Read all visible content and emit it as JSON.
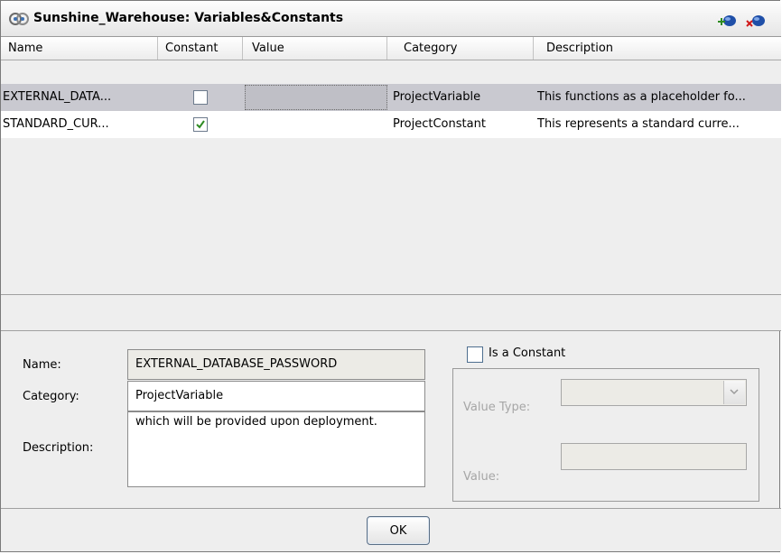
{
  "window": {
    "title": "Sunshine_Warehouse: Variables&Constants",
    "title_icon": "variables-icon",
    "toolbar": [
      {
        "name": "add-variable-button",
        "icon": "add-icon"
      },
      {
        "name": "remove-variable-button",
        "icon": "remove-icon"
      }
    ]
  },
  "table": {
    "columns": [
      "Name",
      "Constant",
      "Value",
      "Category",
      "Description"
    ],
    "rows": [
      {
        "name": "EXTERNAL_DATA...",
        "constant": false,
        "value": "",
        "category": "ProjectVariable",
        "description": "This functions as a placeholder fo...",
        "selected": true
      },
      {
        "name": "STANDARD_CUR...",
        "constant": true,
        "value": "",
        "category": "ProjectConstant",
        "description": "This represents a standard curre...",
        "selected": false
      }
    ]
  },
  "form": {
    "name_label": "Name:",
    "name_value": "EXTERNAL_DATABASE_PASSWORD",
    "category_label": "Category:",
    "category_value": "ProjectVariable",
    "description_label": "Description:",
    "description_value": "which will be provided upon deployment.",
    "is_constant_label": "Is a Constant",
    "is_constant_checked": false,
    "value_type_label": "Value Type:",
    "value_type_selected": "",
    "value_label": "Value:",
    "value_value": ""
  },
  "footer": {
    "ok_label": "OK"
  },
  "colors": {
    "selected_row": "#c9c9d0",
    "checkmark": "#2e8b22",
    "window_bg": "#eeeeee"
  }
}
